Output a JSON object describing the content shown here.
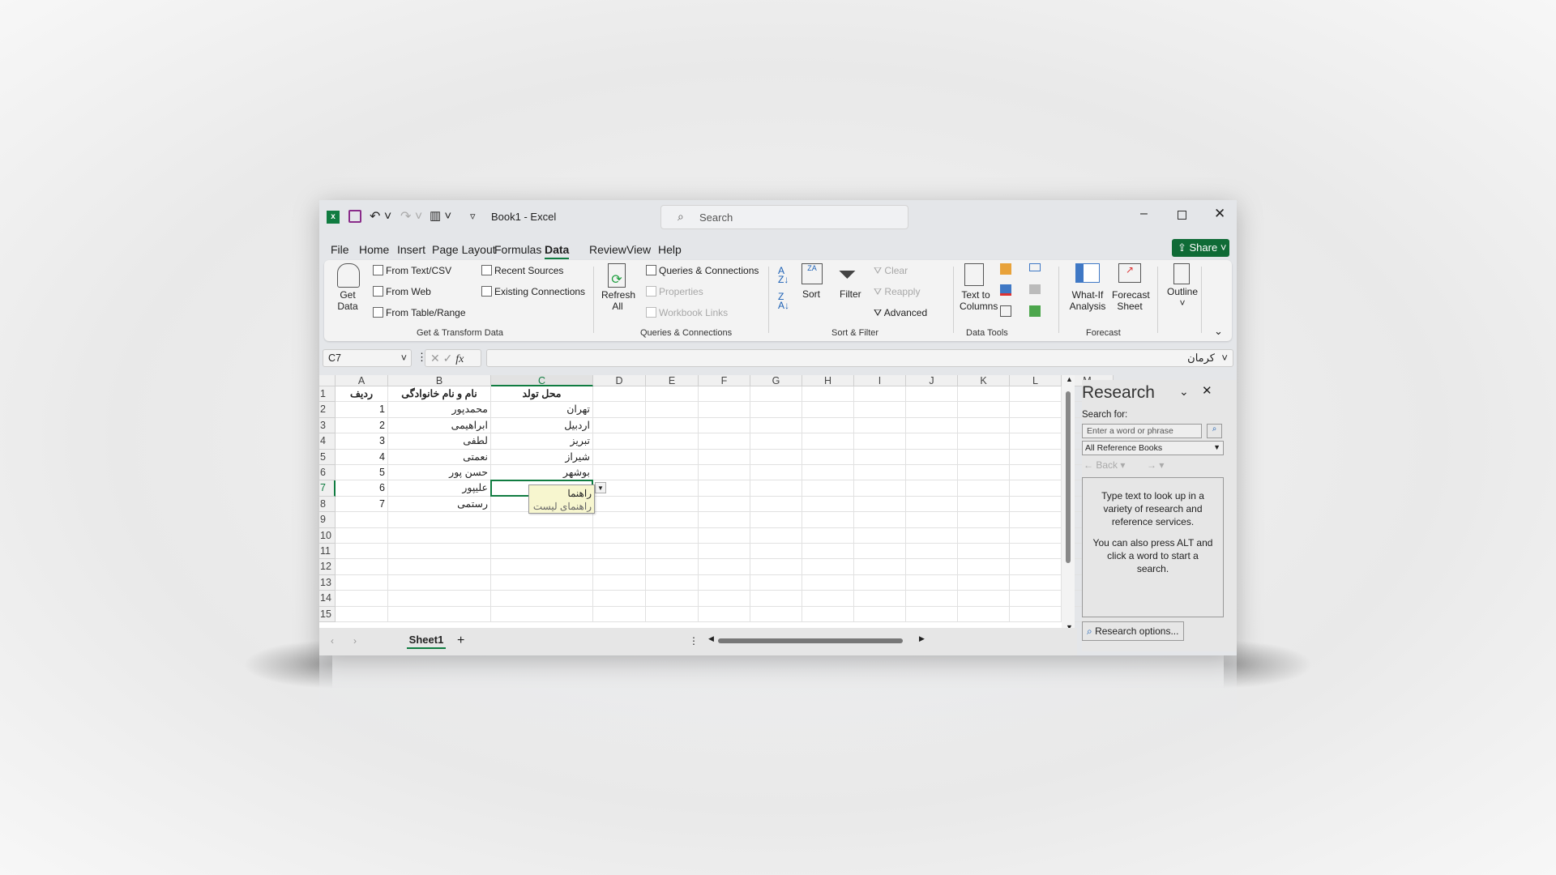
{
  "titlebar": {
    "title": "Book1  -  Excel",
    "search_placeholder": "Search",
    "share": "Share"
  },
  "menu": [
    "File",
    "Home",
    "Insert",
    "Page Layout",
    "Formulas",
    "Data",
    "Review",
    "View",
    "Help"
  ],
  "active_tab": "Data",
  "ribbon": {
    "get_data": "Get Data",
    "from_text": "From Text/CSV",
    "from_web": "From Web",
    "from_table": "From Table/Range",
    "recent": "Recent Sources",
    "existing": "Existing Connections",
    "group1": "Get & Transform Data",
    "refresh": "Refresh All",
    "queries": "Queries & Connections",
    "properties": "Properties",
    "links": "Workbook Links",
    "group2": "Queries & Connections",
    "sort": "Sort",
    "filter": "Filter",
    "clear": "Clear",
    "reapply": "Reapply",
    "advanced": "Advanced",
    "group3": "Sort & Filter",
    "text_to_columns": "Text to Columns",
    "group4": "Data Tools",
    "whatif": "What-If Analysis",
    "forecast_sheet": "Forecast Sheet",
    "group5": "Forecast",
    "outline": "Outline"
  },
  "formula": {
    "name_box": "C7",
    "value": "کرمان",
    "fx": "fx"
  },
  "columns": [
    "A",
    "B",
    "C",
    "D",
    "E",
    "F",
    "G",
    "H",
    "I",
    "J",
    "K",
    "L",
    "M"
  ],
  "rows": [
    [
      "ردیف",
      "نام و نام خانوادگی",
      "محل تولد"
    ],
    [
      "1",
      "محمدپور",
      "تهران"
    ],
    [
      "2",
      "ابراهیمی",
      "اردبیل"
    ],
    [
      "3",
      "لطفی",
      "تبریز"
    ],
    [
      "4",
      "نعمتی",
      "شیراز"
    ],
    [
      "5",
      "حسن پور",
      "بوشهر"
    ],
    [
      "6",
      "علیپور",
      ""
    ],
    [
      "7",
      "رستمی",
      ""
    ]
  ],
  "row_count": 15,
  "selected_cell": "C7",
  "validation_tooltip": {
    "title": "راهنما",
    "message": "راهنمای لیست"
  },
  "sheets": [
    "Sheet1"
  ],
  "research": {
    "title": "Research",
    "search_for": "Search for:",
    "placeholder": "Enter a word or phrase",
    "source": "All Reference Books",
    "back": "Back",
    "help1": "Type text to look up in a variety of research and reference services.",
    "help2": "You can also press ALT and click a word to start a search.",
    "options": "Research options..."
  },
  "colors": {
    "accent": "#107c41",
    "tooltip": "#f7f6cf"
  }
}
